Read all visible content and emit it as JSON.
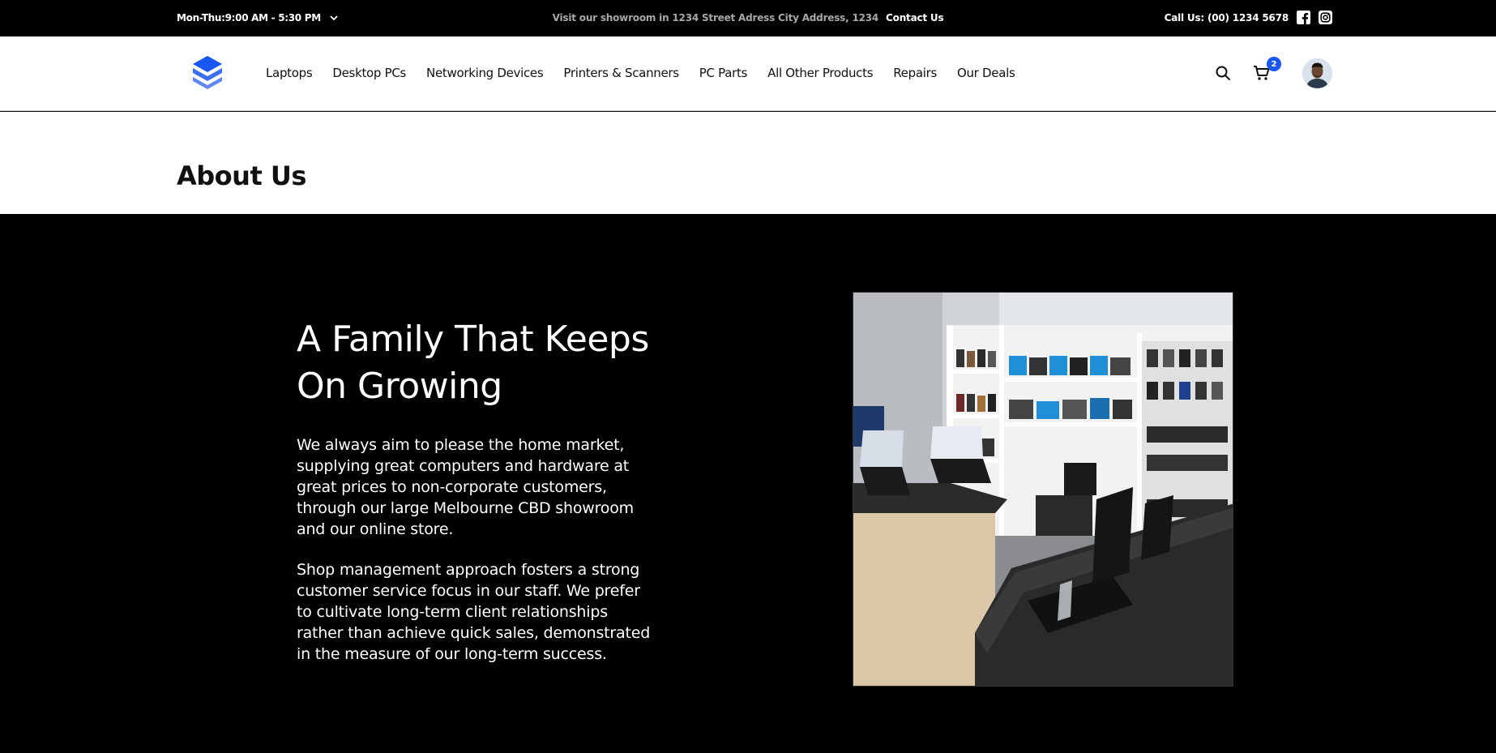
{
  "topbar": {
    "hours": "Mon-Thu:9:00 AM - 5:30 PM",
    "showroom_text": "Visit our showroom in 1234 Street Adress City Address, 1234",
    "contact_link": "Contact Us",
    "phone": "Call Us: (00) 1234 5678",
    "social_icons": [
      "facebook-icon",
      "instagram-icon"
    ]
  },
  "nav": {
    "items": [
      "Laptops",
      "Desktop PCs",
      "Networking Devices",
      "Printers & Scanners",
      "PC Parts",
      "All Other Products",
      "Repairs",
      "Our Deals"
    ],
    "cart_count": "2",
    "icons": [
      "search-icon",
      "cart-icon"
    ]
  },
  "page": {
    "title": "About Us"
  },
  "about": {
    "heading": "A Family That Keeps On Growing",
    "paragraph1": "We always aim to please the home market, supplying great computers and hardware at great prices to non-corporate customers, through our large Melbourne CBD showroom and our online store.",
    "paragraph2": "Shop management approach fosters a strong customer service focus in our staff. We prefer to cultivate long-term client relationships rather than achieve quick sales, demonstrated in the measure of our long-term success."
  },
  "colors": {
    "accent": "#1a56f0",
    "dark": "#000000",
    "light": "#ffffff"
  }
}
